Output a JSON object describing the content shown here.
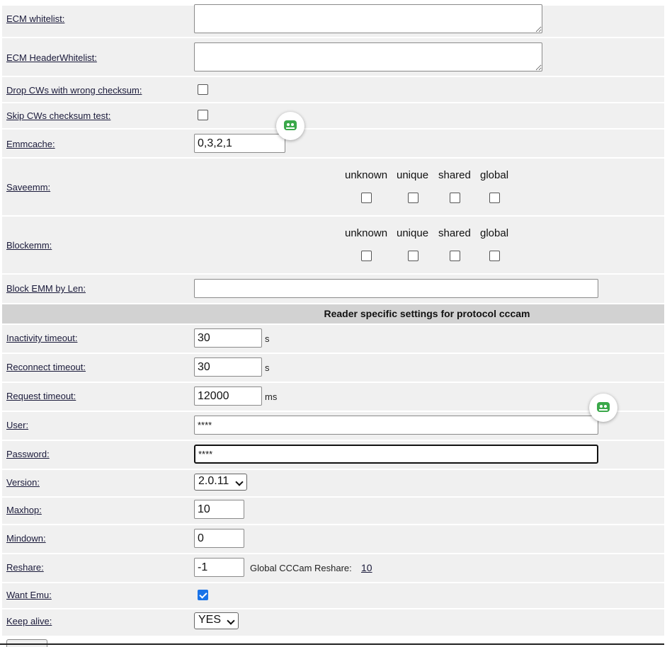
{
  "rows": {
    "ecm_whitelist": {
      "label": "ECM whitelist:",
      "value": ""
    },
    "ecm_header_whitelist": {
      "label": "ECM HeaderWhitelist:",
      "value": ""
    },
    "drop_cws": {
      "label": "Drop CWs with wrong checksum:",
      "checked": false
    },
    "skip_cws": {
      "label": "Skip CWs checksum test:",
      "checked": false
    },
    "emmcache": {
      "label": "Emmcache:",
      "value": "0,3,2,1"
    },
    "saveemm": {
      "label": "Saveemm:",
      "columns": [
        "unknown",
        "unique",
        "shared",
        "global"
      ]
    },
    "blockemm": {
      "label": "Blockemm:",
      "columns": [
        "unknown",
        "unique",
        "shared",
        "global"
      ]
    },
    "block_emm_len": {
      "label": "Block EMM by Len:",
      "value": ""
    }
  },
  "section": {
    "title": "Reader specific settings for protocol cccam"
  },
  "cccam": {
    "inactivity": {
      "label": "Inactivity timeout:",
      "value": "30",
      "unit": "s"
    },
    "reconnect": {
      "label": "Reconnect timeout:",
      "value": "30",
      "unit": "s"
    },
    "request": {
      "label": "Request timeout:",
      "value": "12000",
      "unit": "ms"
    },
    "user": {
      "label": "User:",
      "value": "****"
    },
    "password": {
      "label": "Password:",
      "value": "****"
    },
    "version": {
      "label": "Version:",
      "value": "2.0.11"
    },
    "maxhop": {
      "label": "Maxhop:",
      "value": "10"
    },
    "mindown": {
      "label": "Mindown:",
      "value": "0"
    },
    "reshare": {
      "label": "Reshare:",
      "value": "-1",
      "global_label": "Global CCCam Reshare:",
      "global_value": "10"
    },
    "want_emu": {
      "label": "Want Emu:",
      "checked": true
    },
    "keep_alive": {
      "label": "Keep alive:",
      "value": "YES"
    }
  },
  "icons": {
    "password_manager": "robot-face-icon",
    "accent": "#3aa84a"
  }
}
